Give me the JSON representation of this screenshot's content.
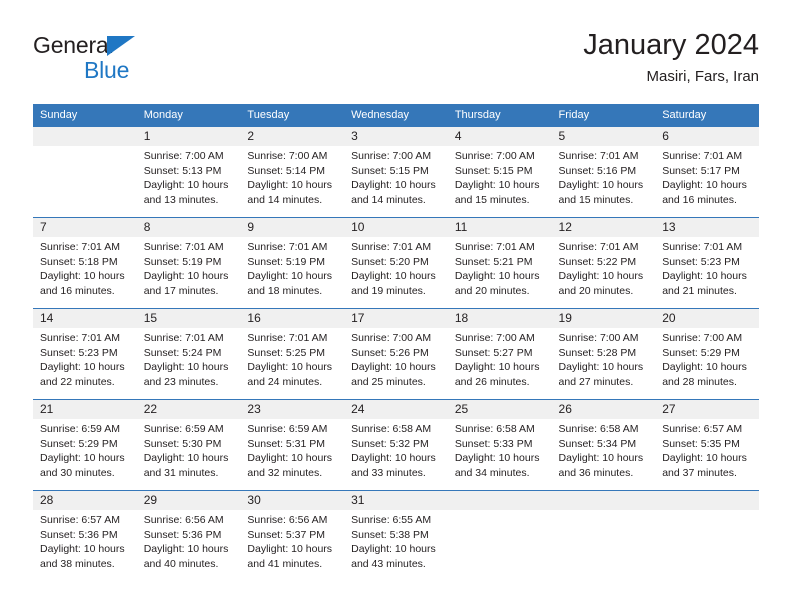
{
  "brand": {
    "name_part1": "General",
    "name_part2": "Blue",
    "accent_color": "#1f77c4"
  },
  "header": {
    "title": "January 2024",
    "subtitle": "Masiri, Fars, Iran"
  },
  "colors": {
    "header_blue": "#3577b9",
    "daynum_gray": "#f0f0f0",
    "text": "#231f20"
  },
  "weekday_headers": [
    "Sunday",
    "Monday",
    "Tuesday",
    "Wednesday",
    "Thursday",
    "Friday",
    "Saturday"
  ],
  "weeks": [
    [
      {
        "day": "",
        "sunrise": "",
        "sunset": "",
        "daylight1": "",
        "daylight2": ""
      },
      {
        "day": "1",
        "sunrise": "Sunrise: 7:00 AM",
        "sunset": "Sunset: 5:13 PM",
        "daylight1": "Daylight: 10 hours",
        "daylight2": "and 13 minutes."
      },
      {
        "day": "2",
        "sunrise": "Sunrise: 7:00 AM",
        "sunset": "Sunset: 5:14 PM",
        "daylight1": "Daylight: 10 hours",
        "daylight2": "and 14 minutes."
      },
      {
        "day": "3",
        "sunrise": "Sunrise: 7:00 AM",
        "sunset": "Sunset: 5:15 PM",
        "daylight1": "Daylight: 10 hours",
        "daylight2": "and 14 minutes."
      },
      {
        "day": "4",
        "sunrise": "Sunrise: 7:00 AM",
        "sunset": "Sunset: 5:15 PM",
        "daylight1": "Daylight: 10 hours",
        "daylight2": "and 15 minutes."
      },
      {
        "day": "5",
        "sunrise": "Sunrise: 7:01 AM",
        "sunset": "Sunset: 5:16 PM",
        "daylight1": "Daylight: 10 hours",
        "daylight2": "and 15 minutes."
      },
      {
        "day": "6",
        "sunrise": "Sunrise: 7:01 AM",
        "sunset": "Sunset: 5:17 PM",
        "daylight1": "Daylight: 10 hours",
        "daylight2": "and 16 minutes."
      }
    ],
    [
      {
        "day": "7",
        "sunrise": "Sunrise: 7:01 AM",
        "sunset": "Sunset: 5:18 PM",
        "daylight1": "Daylight: 10 hours",
        "daylight2": "and 16 minutes."
      },
      {
        "day": "8",
        "sunrise": "Sunrise: 7:01 AM",
        "sunset": "Sunset: 5:19 PM",
        "daylight1": "Daylight: 10 hours",
        "daylight2": "and 17 minutes."
      },
      {
        "day": "9",
        "sunrise": "Sunrise: 7:01 AM",
        "sunset": "Sunset: 5:19 PM",
        "daylight1": "Daylight: 10 hours",
        "daylight2": "and 18 minutes."
      },
      {
        "day": "10",
        "sunrise": "Sunrise: 7:01 AM",
        "sunset": "Sunset: 5:20 PM",
        "daylight1": "Daylight: 10 hours",
        "daylight2": "and 19 minutes."
      },
      {
        "day": "11",
        "sunrise": "Sunrise: 7:01 AM",
        "sunset": "Sunset: 5:21 PM",
        "daylight1": "Daylight: 10 hours",
        "daylight2": "and 20 minutes."
      },
      {
        "day": "12",
        "sunrise": "Sunrise: 7:01 AM",
        "sunset": "Sunset: 5:22 PM",
        "daylight1": "Daylight: 10 hours",
        "daylight2": "and 20 minutes."
      },
      {
        "day": "13",
        "sunrise": "Sunrise: 7:01 AM",
        "sunset": "Sunset: 5:23 PM",
        "daylight1": "Daylight: 10 hours",
        "daylight2": "and 21 minutes."
      }
    ],
    [
      {
        "day": "14",
        "sunrise": "Sunrise: 7:01 AM",
        "sunset": "Sunset: 5:23 PM",
        "daylight1": "Daylight: 10 hours",
        "daylight2": "and 22 minutes."
      },
      {
        "day": "15",
        "sunrise": "Sunrise: 7:01 AM",
        "sunset": "Sunset: 5:24 PM",
        "daylight1": "Daylight: 10 hours",
        "daylight2": "and 23 minutes."
      },
      {
        "day": "16",
        "sunrise": "Sunrise: 7:01 AM",
        "sunset": "Sunset: 5:25 PM",
        "daylight1": "Daylight: 10 hours",
        "daylight2": "and 24 minutes."
      },
      {
        "day": "17",
        "sunrise": "Sunrise: 7:00 AM",
        "sunset": "Sunset: 5:26 PM",
        "daylight1": "Daylight: 10 hours",
        "daylight2": "and 25 minutes."
      },
      {
        "day": "18",
        "sunrise": "Sunrise: 7:00 AM",
        "sunset": "Sunset: 5:27 PM",
        "daylight1": "Daylight: 10 hours",
        "daylight2": "and 26 minutes."
      },
      {
        "day": "19",
        "sunrise": "Sunrise: 7:00 AM",
        "sunset": "Sunset: 5:28 PM",
        "daylight1": "Daylight: 10 hours",
        "daylight2": "and 27 minutes."
      },
      {
        "day": "20",
        "sunrise": "Sunrise: 7:00 AM",
        "sunset": "Sunset: 5:29 PM",
        "daylight1": "Daylight: 10 hours",
        "daylight2": "and 28 minutes."
      }
    ],
    [
      {
        "day": "21",
        "sunrise": "Sunrise: 6:59 AM",
        "sunset": "Sunset: 5:29 PM",
        "daylight1": "Daylight: 10 hours",
        "daylight2": "and 30 minutes."
      },
      {
        "day": "22",
        "sunrise": "Sunrise: 6:59 AM",
        "sunset": "Sunset: 5:30 PM",
        "daylight1": "Daylight: 10 hours",
        "daylight2": "and 31 minutes."
      },
      {
        "day": "23",
        "sunrise": "Sunrise: 6:59 AM",
        "sunset": "Sunset: 5:31 PM",
        "daylight1": "Daylight: 10 hours",
        "daylight2": "and 32 minutes."
      },
      {
        "day": "24",
        "sunrise": "Sunrise: 6:58 AM",
        "sunset": "Sunset: 5:32 PM",
        "daylight1": "Daylight: 10 hours",
        "daylight2": "and 33 minutes."
      },
      {
        "day": "25",
        "sunrise": "Sunrise: 6:58 AM",
        "sunset": "Sunset: 5:33 PM",
        "daylight1": "Daylight: 10 hours",
        "daylight2": "and 34 minutes."
      },
      {
        "day": "26",
        "sunrise": "Sunrise: 6:58 AM",
        "sunset": "Sunset: 5:34 PM",
        "daylight1": "Daylight: 10 hours",
        "daylight2": "and 36 minutes."
      },
      {
        "day": "27",
        "sunrise": "Sunrise: 6:57 AM",
        "sunset": "Sunset: 5:35 PM",
        "daylight1": "Daylight: 10 hours",
        "daylight2": "and 37 minutes."
      }
    ],
    [
      {
        "day": "28",
        "sunrise": "Sunrise: 6:57 AM",
        "sunset": "Sunset: 5:36 PM",
        "daylight1": "Daylight: 10 hours",
        "daylight2": "and 38 minutes."
      },
      {
        "day": "29",
        "sunrise": "Sunrise: 6:56 AM",
        "sunset": "Sunset: 5:36 PM",
        "daylight1": "Daylight: 10 hours",
        "daylight2": "and 40 minutes."
      },
      {
        "day": "30",
        "sunrise": "Sunrise: 6:56 AM",
        "sunset": "Sunset: 5:37 PM",
        "daylight1": "Daylight: 10 hours",
        "daylight2": "and 41 minutes."
      },
      {
        "day": "31",
        "sunrise": "Sunrise: 6:55 AM",
        "sunset": "Sunset: 5:38 PM",
        "daylight1": "Daylight: 10 hours",
        "daylight2": "and 43 minutes."
      },
      {
        "day": "",
        "sunrise": "",
        "sunset": "",
        "daylight1": "",
        "daylight2": ""
      },
      {
        "day": "",
        "sunrise": "",
        "sunset": "",
        "daylight1": "",
        "daylight2": ""
      },
      {
        "day": "",
        "sunrise": "",
        "sunset": "",
        "daylight1": "",
        "daylight2": ""
      }
    ]
  ]
}
